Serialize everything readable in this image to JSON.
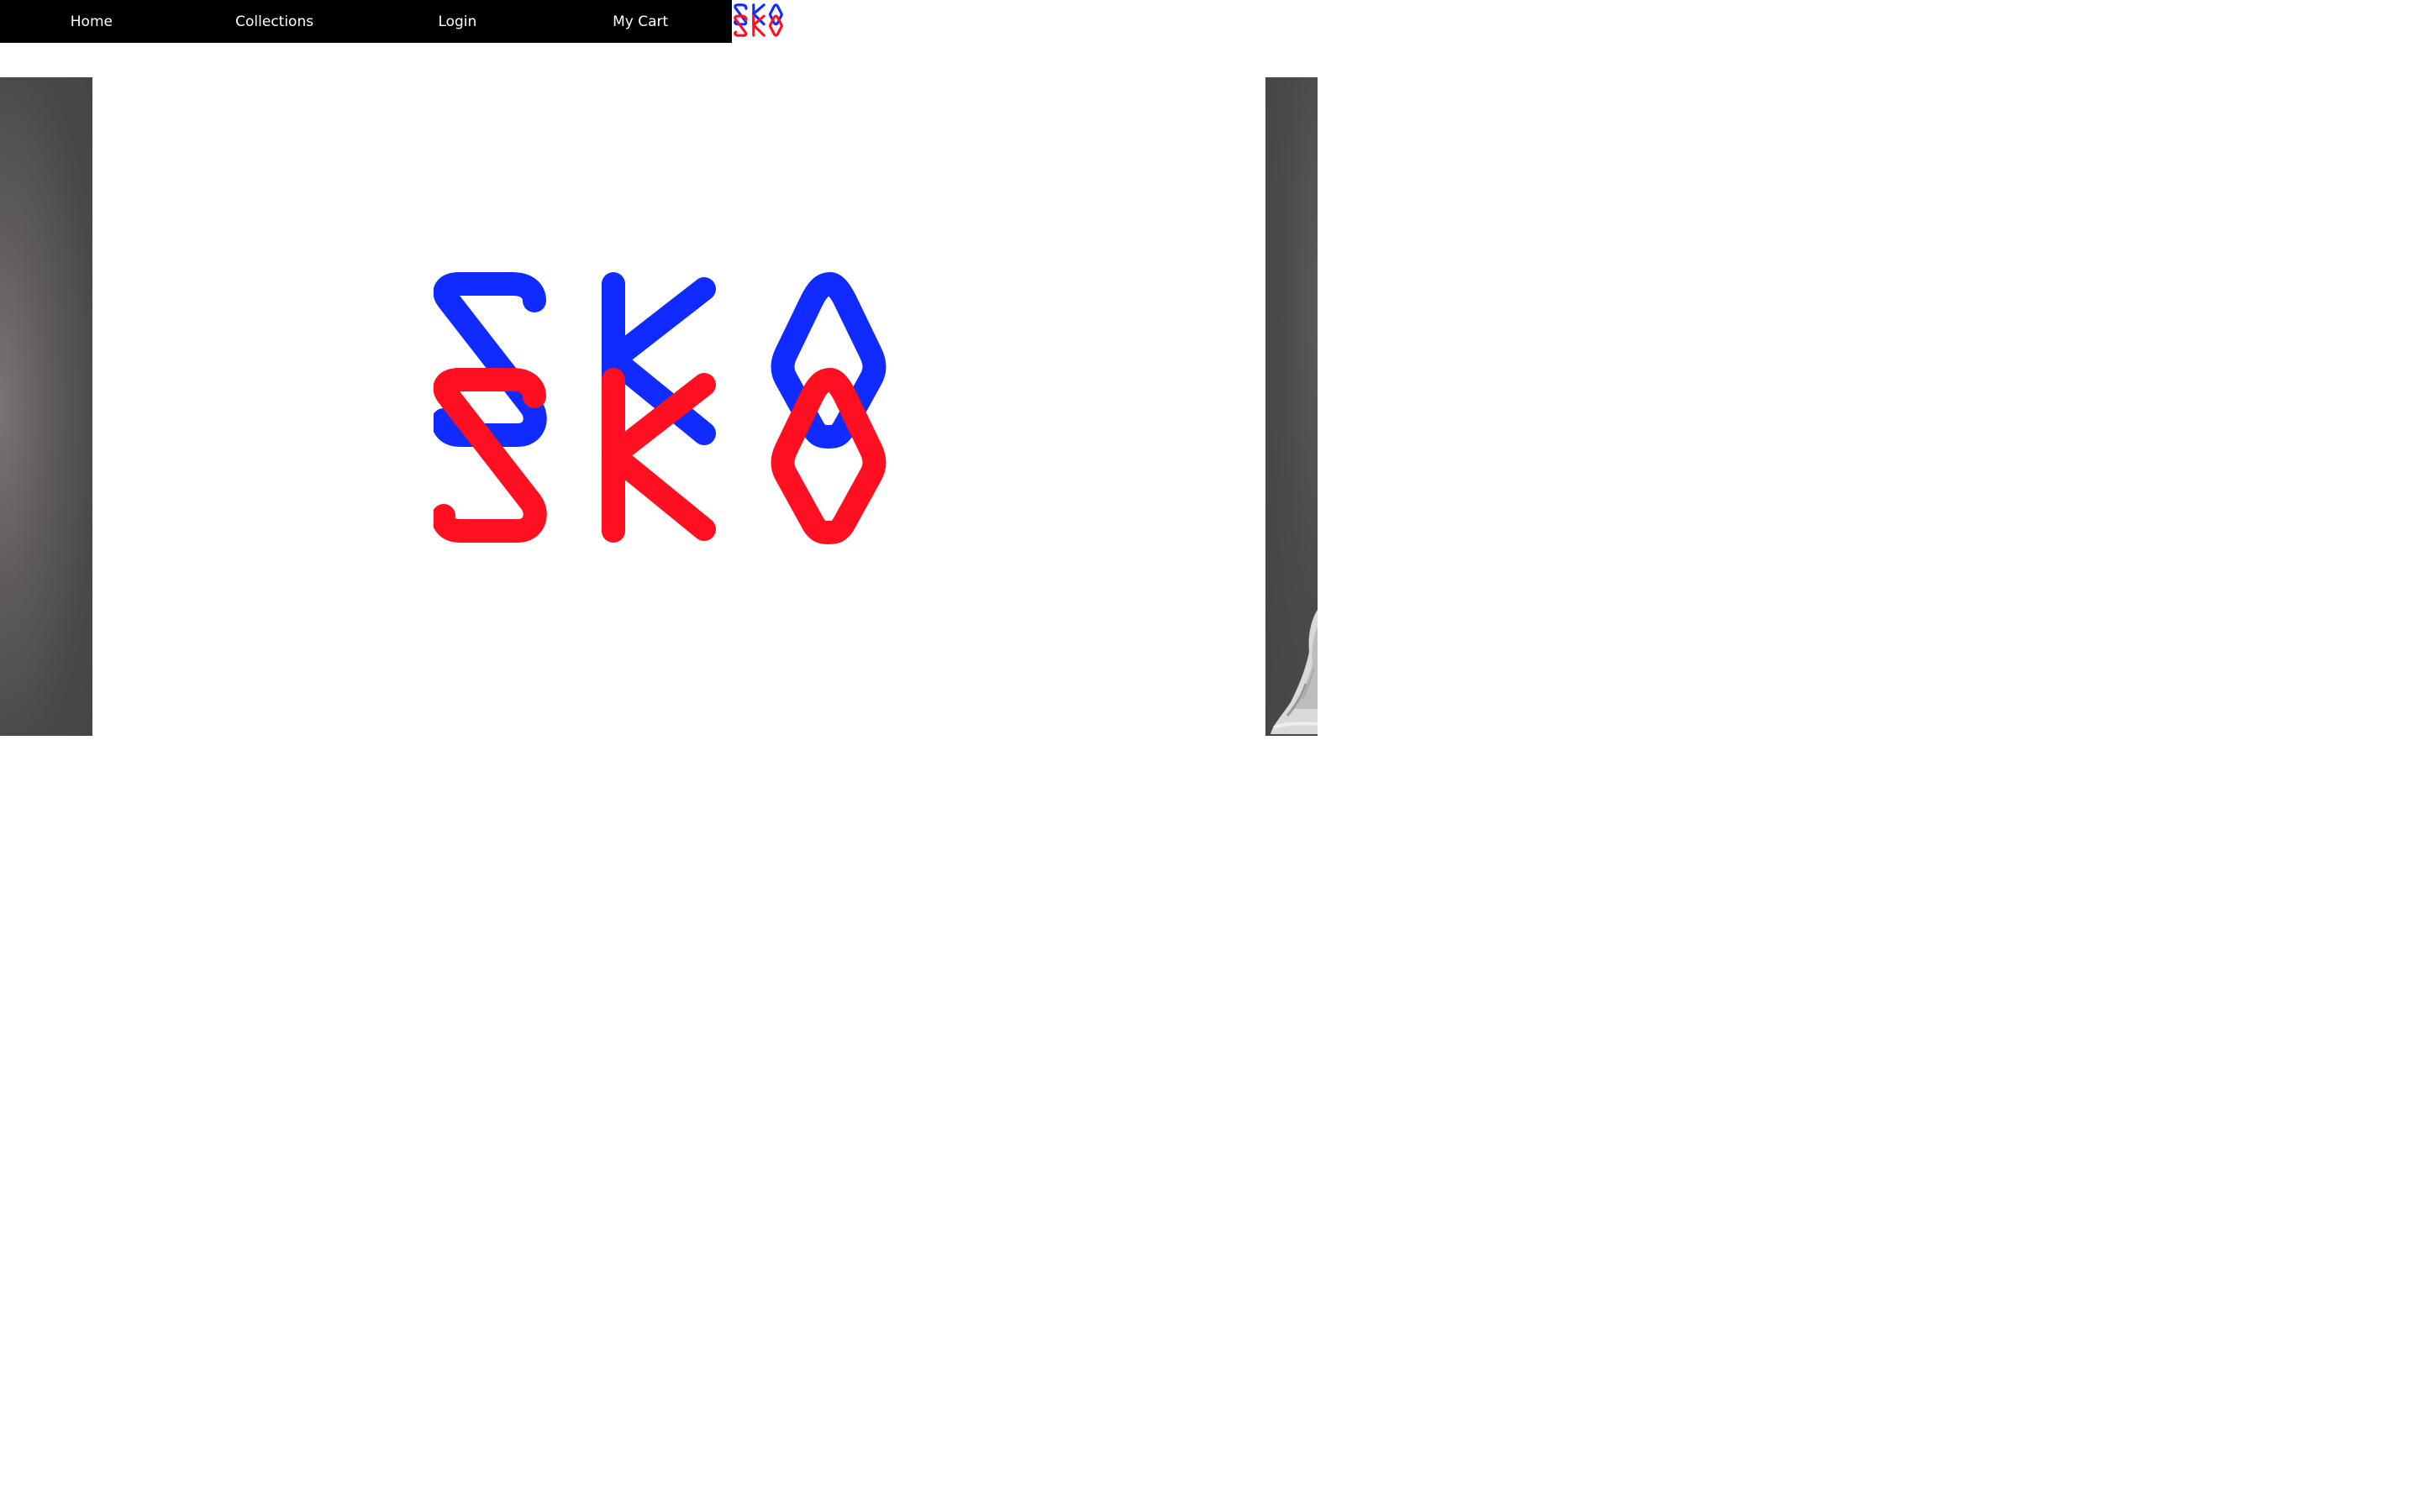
{
  "nav": {
    "items": [
      {
        "label": "Home"
      },
      {
        "label": "Collections"
      },
      {
        "label": "Login"
      },
      {
        "label": "My Cart"
      }
    ]
  },
  "brand": {
    "logo_text": "SKO",
    "colors": {
      "blue": "#0f2bff",
      "red": "#ff0f1f",
      "nav_bg": "#000000",
      "nav_text": "#ffffff"
    }
  },
  "carousel": {
    "icons": [
      "sko-logo-icon",
      "shoe-image"
    ]
  }
}
